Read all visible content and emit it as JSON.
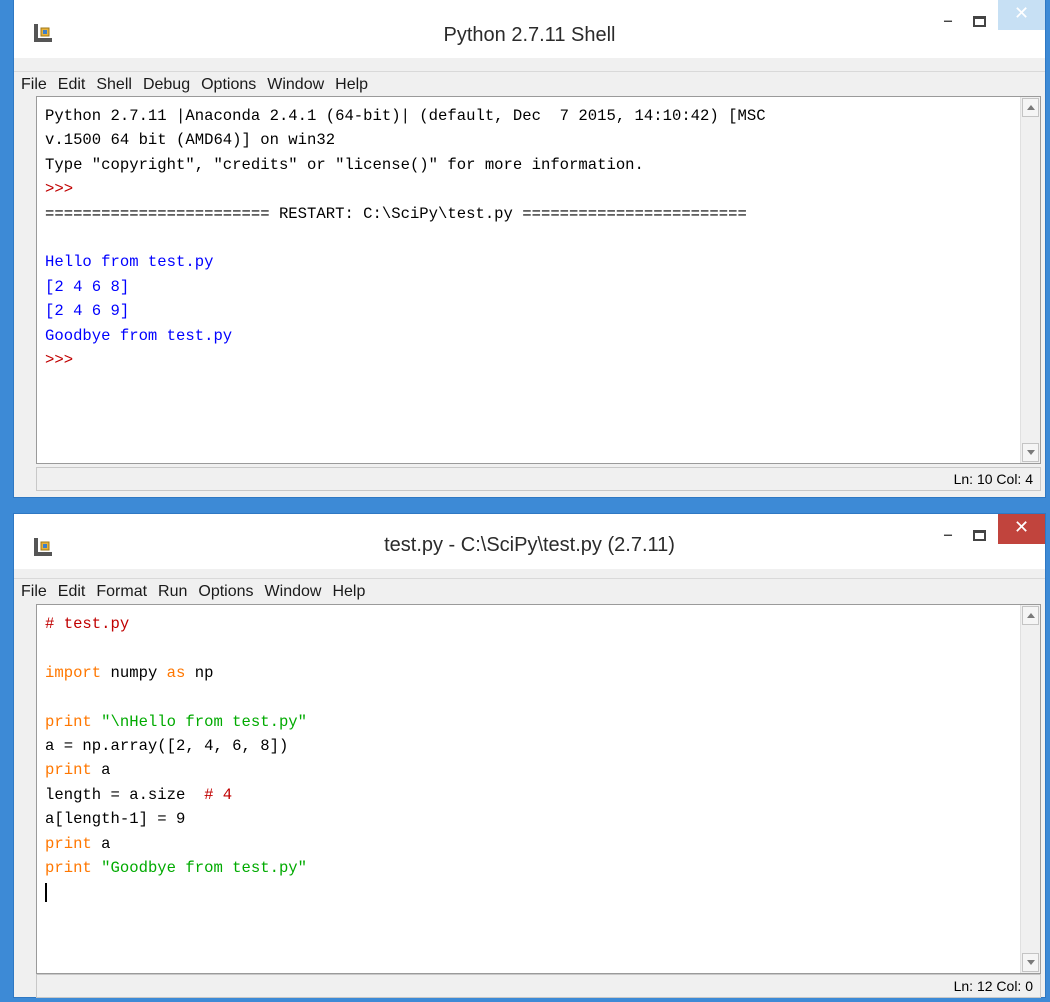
{
  "shell": {
    "title": "Python 2.7.11 Shell",
    "menu": [
      "File",
      "Edit",
      "Shell",
      "Debug",
      "Options",
      "Window",
      "Help"
    ],
    "lines": [
      [
        {
          "t": "Python 2.7.11 |Anaconda 2.4.1 (64-bit)| (default, Dec  7 2015, 14:10:42) [MSC",
          "c": "black"
        }
      ],
      [
        {
          "t": "v.1500 64 bit (AMD64)] on win32",
          "c": "black"
        }
      ],
      [
        {
          "t": "Type \"copyright\", \"credits\" or \"license()\" for more information.",
          "c": "black"
        }
      ],
      [
        {
          "t": ">>> ",
          "c": "red"
        }
      ],
      [
        {
          "t": "======================== RESTART: C:\\SciPy\\test.py ========================",
          "c": "black"
        }
      ],
      [
        {
          "t": "",
          "c": "black"
        }
      ],
      [
        {
          "t": "Hello from test.py",
          "c": "blue"
        }
      ],
      [
        {
          "t": "[2 4 6 8]",
          "c": "blue"
        }
      ],
      [
        {
          "t": "[2 4 6 9]",
          "c": "blue"
        }
      ],
      [
        {
          "t": "Goodbye from test.py",
          "c": "blue"
        }
      ],
      [
        {
          "t": ">>> ",
          "c": "red"
        }
      ]
    ],
    "status": "Ln: 10  Col: 4"
  },
  "editor": {
    "title": "test.py - C:\\SciPy\\test.py (2.7.11)",
    "menu": [
      "File",
      "Edit",
      "Format",
      "Run",
      "Options",
      "Window",
      "Help"
    ],
    "lines": [
      [
        {
          "t": "# test.py",
          "c": "red"
        }
      ],
      [
        {
          "t": "",
          "c": "black"
        }
      ],
      [
        {
          "t": "import",
          "c": "orange"
        },
        {
          "t": " numpy ",
          "c": "black"
        },
        {
          "t": "as",
          "c": "orange"
        },
        {
          "t": " np",
          "c": "black"
        }
      ],
      [
        {
          "t": "",
          "c": "black"
        }
      ],
      [
        {
          "t": "print",
          "c": "orange"
        },
        {
          "t": " ",
          "c": "black"
        },
        {
          "t": "\"\\nHello from test.py\"",
          "c": "green"
        }
      ],
      [
        {
          "t": "a = np.array([2, 4, 6, 8])",
          "c": "black"
        }
      ],
      [
        {
          "t": "print",
          "c": "orange"
        },
        {
          "t": " a",
          "c": "black"
        }
      ],
      [
        {
          "t": "length = a.size  ",
          "c": "black"
        },
        {
          "t": "# 4",
          "c": "red"
        }
      ],
      [
        {
          "t": "a[length-1] = 9",
          "c": "black"
        }
      ],
      [
        {
          "t": "print",
          "c": "orange"
        },
        {
          "t": " a",
          "c": "black"
        }
      ],
      [
        {
          "t": "print",
          "c": "orange"
        },
        {
          "t": " ",
          "c": "black"
        },
        {
          "t": "\"Goodbye from test.py\"",
          "c": "green"
        }
      ]
    ],
    "status": "Ln: 12  Col: 0"
  },
  "icons": {
    "app": "idle-app-icon",
    "minimize": "minimize-icon",
    "maximize": "maximize-icon",
    "close": "close-icon"
  },
  "colors": {
    "desktop": "#3d8ad6",
    "keyword": "#ff7700",
    "string": "#00aa00",
    "comment": "#c00000",
    "output": "#0000ff",
    "close_active": "#c1443d"
  }
}
